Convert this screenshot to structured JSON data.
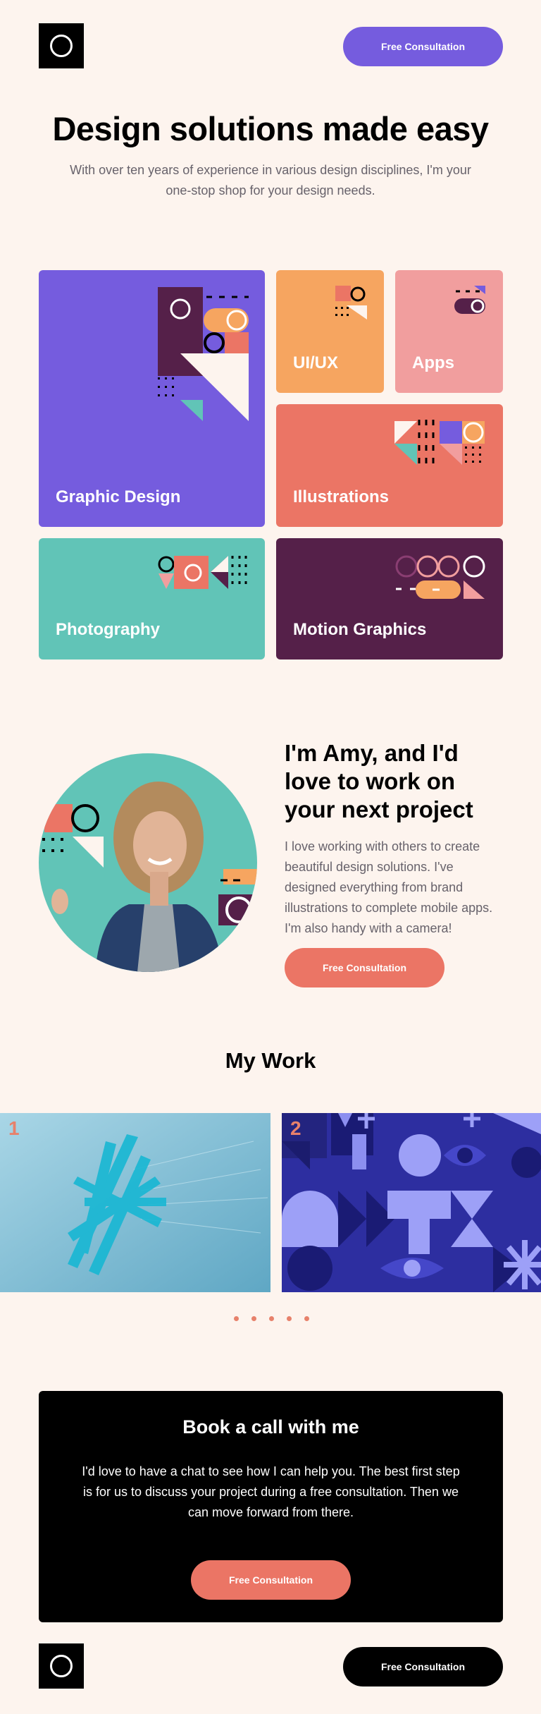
{
  "header": {
    "cta_label": "Free Consultation"
  },
  "hero": {
    "title": "Design solutions made easy",
    "subtitle": "With over ten years of experience in various design disciplines, I'm your one-stop shop for your design needs."
  },
  "services": [
    {
      "label": "Graphic Design",
      "color": "#755cde"
    },
    {
      "label": "UI/UX",
      "color": "#f6a560"
    },
    {
      "label": "Apps",
      "color": "#f19e9e"
    },
    {
      "label": "Illustrations",
      "color": "#eb7565"
    },
    {
      "label": "Photography",
      "color": "#61c4b7"
    },
    {
      "label": "Motion Graphics",
      "color": "#552049"
    }
  ],
  "about": {
    "title": "I'm Amy, and I'd love to work on your next project",
    "text": "I love working with others to create beautiful design solutions. I've designed everything from brand illustrations to complete mobile apps. I'm also handy with a camera!",
    "cta_label": "Free Consultation"
  },
  "work": {
    "title": "My Work",
    "slides": [
      {
        "number": "1"
      },
      {
        "number": "2"
      }
    ],
    "dots": 5
  },
  "book": {
    "title": "Book a call with me",
    "text": "I'd love to have a chat to see how I can help you. The best first step is for us to discuss your project during a free consultation. Then we can move forward from there.",
    "cta_label": "Free Consultation"
  },
  "footer": {
    "cta_label": "Free Consultation"
  },
  "colors": {
    "bg": "#fdf4ee",
    "purple": "#755cde",
    "coral": "#e7816b",
    "orange": "#f6a560",
    "pink": "#f19e9e",
    "teal": "#61c4b7",
    "plum": "#552049",
    "black": "#000000"
  }
}
